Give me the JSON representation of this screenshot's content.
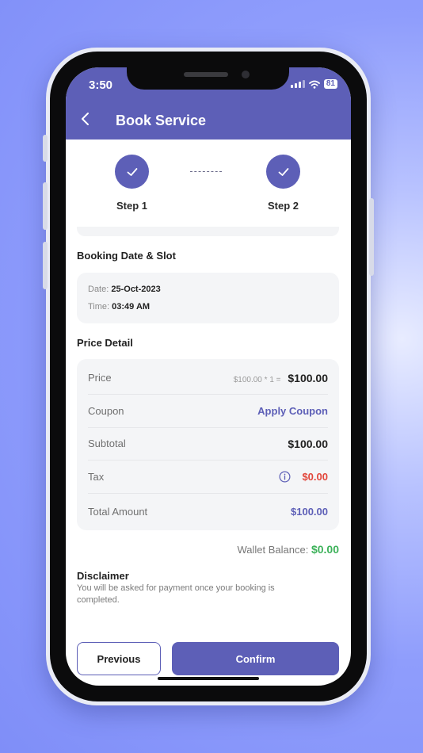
{
  "status_bar": {
    "time": "3:50",
    "battery": "81"
  },
  "header": {
    "title": "Book Service"
  },
  "steps": [
    {
      "label": "Step 1"
    },
    {
      "label": "Step 2"
    }
  ],
  "booking": {
    "section_title": "Booking Date & Slot",
    "date_label": "Date:",
    "date_value": "25-Oct-2023",
    "time_label": "Time:",
    "time_value": "03:49 AM"
  },
  "price_detail": {
    "section_title": "Price Detail",
    "price_label": "Price",
    "price_breakdown": "$100.00  * 1  =",
    "price_value": "$100.00",
    "coupon_label": "Coupon",
    "coupon_action": "Apply Coupon",
    "subtotal_label": "Subtotal",
    "subtotal_value": "$100.00",
    "tax_label": "Tax",
    "tax_value": "$0.00",
    "total_label": "Total Amount",
    "total_value": "$100.00"
  },
  "wallet": {
    "label": "Wallet Balance:",
    "value": "$0.00"
  },
  "disclaimer": {
    "title": "Disclaimer",
    "text": "You will be asked for payment once your booking is completed."
  },
  "actions": {
    "previous_label": "Previous",
    "confirm_label": "Confirm"
  },
  "colors": {
    "primary": "#5d5fb7",
    "tax_red": "#e2463a",
    "wallet_green": "#3db25a"
  },
  "icons": [
    "back-arrow-icon",
    "check-icon",
    "info-icon",
    "signal-icon",
    "wifi-icon",
    "battery-icon"
  ]
}
